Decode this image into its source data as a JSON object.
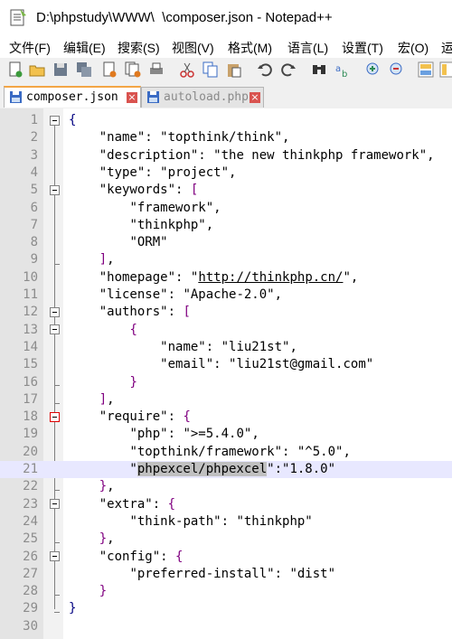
{
  "window": {
    "title": "D:\\phpstudy\\WWW\\  \\composer.json - Notepad++"
  },
  "menu": [
    "文件(F)",
    "编辑(E)",
    "搜索(S)",
    "视图(V)",
    "格式(M)",
    "语言(L)",
    "设置(T)",
    "宏(O)",
    "运"
  ],
  "tabs": [
    {
      "label": "composer.json",
      "active": true
    },
    {
      "label": "autoload.php",
      "active": false
    }
  ],
  "icons": [
    "new-file-icon",
    "open-file-icon",
    "save-icon",
    "save-all-icon",
    "close-icon",
    "close-all-icon",
    "print-icon",
    "cut-icon",
    "copy-icon",
    "paste-icon",
    "undo-icon",
    "redo-icon",
    "find-icon",
    "replace-icon",
    "zoom-in-icon",
    "zoom-out-icon",
    "sync-v-icon",
    "sync-h-icon"
  ],
  "lines": [
    "1",
    "2",
    "3",
    "4",
    "5",
    "6",
    "7",
    "8",
    "9",
    "10",
    "11",
    "12",
    "13",
    "14",
    "15",
    "16",
    "17",
    "18",
    "19",
    "20",
    "21",
    "22",
    "23",
    "24",
    "25",
    "26",
    "27",
    "28",
    "29",
    "30"
  ],
  "code": {
    "l1": "{",
    "l2_key": "\"name\"",
    "l2_val": "\"topthink/think\"",
    "l3_key": "\"description\"",
    "l3_val": "\"the new thinkphp framework\"",
    "l4_key": "\"type\"",
    "l4_val": "\"project\"",
    "l5_key": "\"keywords\"",
    "l6": "\"framework\"",
    "l7": "\"thinkphp\"",
    "l8": "\"ORM\"",
    "l10_key": "\"homepage\"",
    "l10_val": "http://thinkphp.cn/",
    "l11_key": "\"license\"",
    "l11_val": "\"Apache-2.0\"",
    "l12_key": "\"authors\"",
    "l14_key": "\"name\"",
    "l14_val": "\"liu21st\"",
    "l15_key": "\"email\"",
    "l15_val": "\"liu21st@gmail.com\"",
    "l18_key": "\"require\"",
    "l19_key": "\"php\"",
    "l19_val": "\">=5.4.0\"",
    "l20_key": "\"topthink/framework\"",
    "l20_val": "\"^5.0\"",
    "l21_key": "phpexcel/phpexcel",
    "l21_val": "\"1.8.0\"",
    "l23_key": "\"extra\"",
    "l24_key": "\"think-path\"",
    "l24_val": "\"thinkphp\"",
    "l26_key": "\"config\"",
    "l27_key": "\"preferred-install\"",
    "l27_val": "\"dist\""
  }
}
